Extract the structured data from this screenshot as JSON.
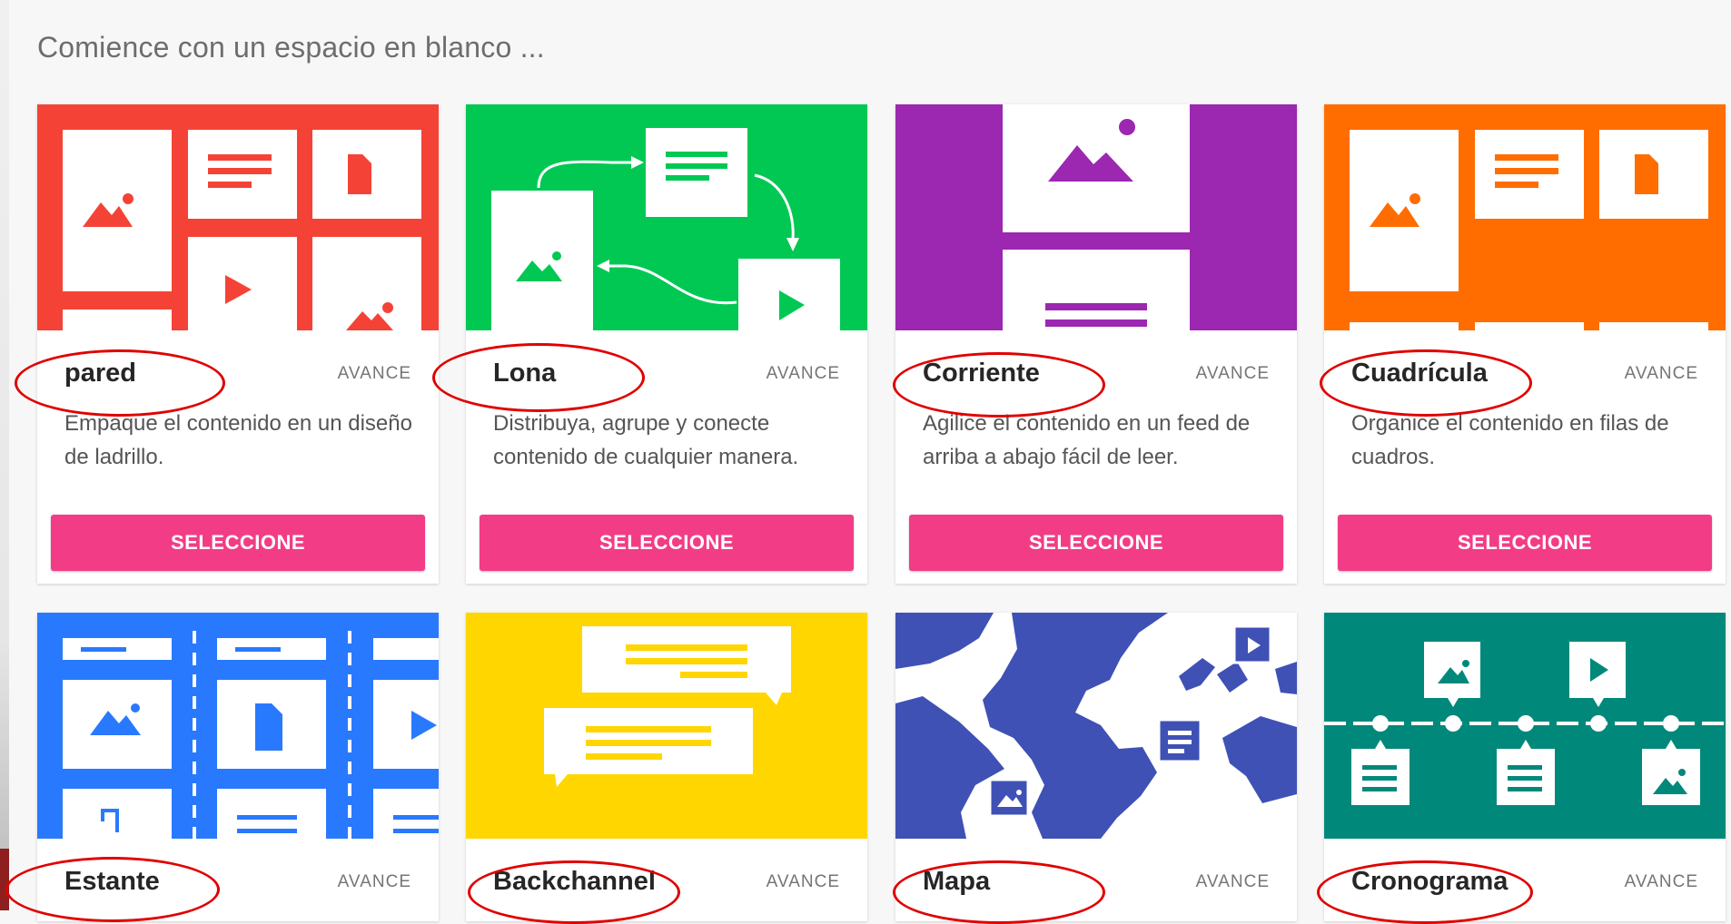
{
  "heading": "Comience con un espacio en blanco ...",
  "preview_label": "AVANCE",
  "select_label": "SELECCIONE",
  "colors": {
    "pared": "#f44336",
    "lona": "#00c853",
    "corriente": "#9c27b0",
    "cuadricula": "#ff6d00",
    "estante": "#2979ff",
    "backchannel": "#ffd600",
    "mapa": "#3f51b5",
    "cronograma": "#00897b",
    "button": "#f23d86",
    "highlight": "#e00000"
  },
  "layouts": [
    {
      "title": "pared",
      "description": "Empaque el contenido en un diseño de ladrillo."
    },
    {
      "title": "Lona",
      "description": "Distribuya, agrupe y conecte contenido de cualquier manera."
    },
    {
      "title": "Corriente",
      "description": "Agilice el contenido en un feed de arriba a abajo fácil de leer."
    },
    {
      "title": "Cuadrícula",
      "description": "Organice el contenido en filas de cuadros."
    },
    {
      "title": "Estante",
      "description": ""
    },
    {
      "title": "Backchannel",
      "description": ""
    },
    {
      "title": "Mapa",
      "description": ""
    },
    {
      "title": "Cronograma",
      "description": ""
    }
  ]
}
